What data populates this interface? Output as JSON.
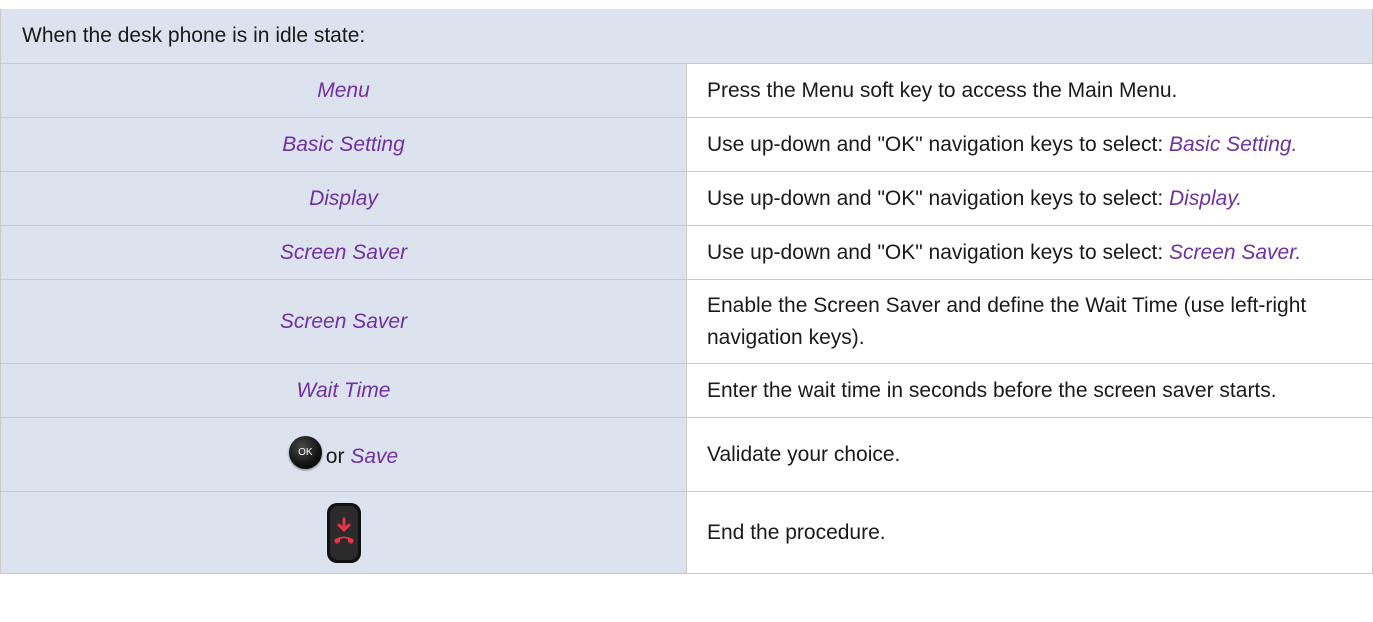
{
  "header": "When the desk phone is in idle state:",
  "rows": [
    {
      "left": "Menu",
      "right": "Press the Menu soft key to access the Main Menu."
    },
    {
      "left": "Basic Setting",
      "right_prefix": "Use up-down and \"OK\" navigation keys to select: ",
      "right_italic": "Basic Setting."
    },
    {
      "left": "Display",
      "right_prefix": "Use up-down and \"OK\" navigation keys to select: ",
      "right_italic": "Display."
    },
    {
      "left": "Screen Saver",
      "right_prefix": "Use up-down and \"OK\" navigation keys to select: ",
      "right_italic": "Screen Saver."
    },
    {
      "left": "Screen Saver",
      "right": "Enable the Screen Saver and define the Wait Time (use left-right navigation keys)."
    },
    {
      "left": "Wait Time",
      "right": "Enter the wait time in seconds before the screen saver starts."
    },
    {
      "left_key": "OK",
      "left_or": "or",
      "left": "Save",
      "right": "Validate your choice."
    },
    {
      "left_icon": "hang-up-key-icon",
      "right": "End the procedure."
    }
  ],
  "colors": {
    "header_bg": "#dce3ee",
    "italic_text": "#7030a0",
    "grid": "#c9c9c9",
    "hangup_red": "#e8334a"
  }
}
